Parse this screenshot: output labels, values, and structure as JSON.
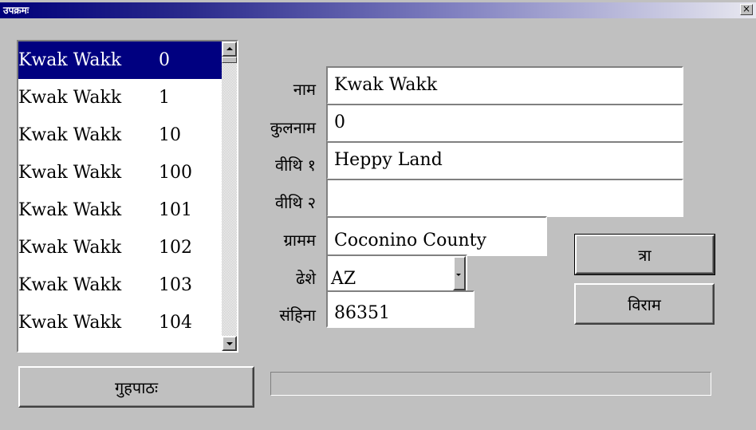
{
  "window": {
    "title": "उपक्रमः",
    "close_label": "×"
  },
  "list": {
    "items": [
      {
        "name": "Kwak Wakk",
        "num": "0",
        "selected": true
      },
      {
        "name": "Kwak Wakk",
        "num": "1"
      },
      {
        "name": "Kwak Wakk",
        "num": "10"
      },
      {
        "name": "Kwak Wakk",
        "num": "100"
      },
      {
        "name": "Kwak Wakk",
        "num": "101"
      },
      {
        "name": "Kwak Wakk",
        "num": "102"
      },
      {
        "name": "Kwak Wakk",
        "num": "103"
      },
      {
        "name": "Kwak Wakk",
        "num": "104"
      }
    ]
  },
  "form": {
    "name_label": "नाम",
    "name_value": "Kwak Wakk",
    "surname_label": "कुलनाम",
    "surname_value": "0",
    "street1_label": "वीथि १",
    "street1_value": "Heppy Land",
    "street2_label": "वीथि २",
    "street2_value": "",
    "village_label": "ग्रामम",
    "village_value": "Coconino County",
    "state_label": "ढेशे",
    "state_value": "AZ",
    "zip_label": "संहिना",
    "zip_value": "86351"
  },
  "buttons": {
    "ok_label": "त्रा",
    "stop_label": "विराम",
    "load_label": "गुहपाठः"
  },
  "progress": {
    "value": 0
  },
  "colors": {
    "selection": "#000080",
    "face": "#c0c0c0"
  }
}
